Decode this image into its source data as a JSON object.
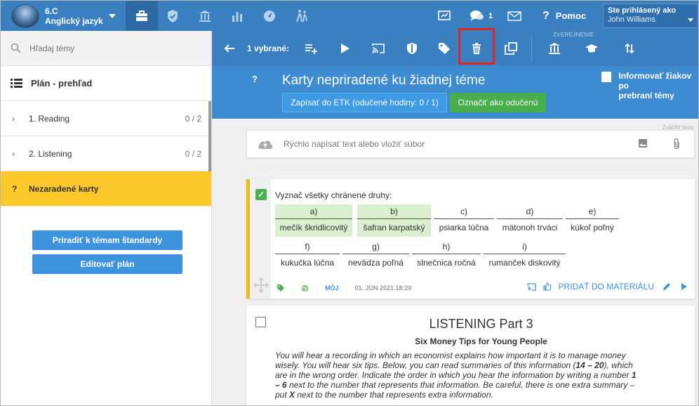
{
  "topbar": {
    "class_code": "6.C",
    "class_name": "Anglický jazyk",
    "chat_count": "1",
    "help_label": "Pomoc",
    "user_label": "Ste prihlásený ako",
    "user_name": "John Williams"
  },
  "sidebar": {
    "search_placeholder": "Hľadaj témy",
    "plan_label": "Plán - prehľad",
    "items": [
      {
        "chev": "›",
        "label": "1. Reading",
        "count": "0 / 2"
      },
      {
        "chev": "›",
        "label": "2. Listening",
        "count": "0 / 2"
      },
      {
        "chev": "?",
        "label": "Nezaradené karty",
        "count": ""
      }
    ],
    "assign_button": "Priradiť k témam štandardy",
    "edit_button": "Editovať plán"
  },
  "actionbar": {
    "selected_label": "1 vybrané:",
    "published_label": "ZVEREJNENIE"
  },
  "header": {
    "qmark": "?",
    "title": "Karty nepriradené ku žiadnej téme",
    "etk_button": "Zapísať do ETK (odučené hodiny: 0 / 1)",
    "done_button": "Označiť ako odučenú",
    "inform_line1": "Informovať žiakov po",
    "inform_line2": "prebraní témy"
  },
  "content": {
    "tiny_note": "Zväčšiť texty",
    "quick_placeholder": "Rýchlo napísať text alebo vložiť súbor",
    "card1": {
      "prompt": "Vyznač všetky chránené druhy:",
      "options": [
        {
          "letter": "a)",
          "value": "mečík škridlicovitý",
          "selected": true
        },
        {
          "letter": "b)",
          "value": "šafran karpatský",
          "selected": true
        },
        {
          "letter": "c)",
          "value": "psiarka lúčna",
          "selected": false
        },
        {
          "letter": "d)",
          "value": "mätonoh trváci",
          "selected": false
        },
        {
          "letter": "e)",
          "value": "kúkoľ poľný",
          "selected": false
        },
        {
          "letter": "f)",
          "value": "kukučka lúčna",
          "selected": false
        },
        {
          "letter": "g)",
          "value": "nevädza poľná",
          "selected": false
        },
        {
          "letter": "h)",
          "value": "slnečnica ročná",
          "selected": false
        },
        {
          "letter": "i)",
          "value": "rumanček diskovitý",
          "selected": false
        }
      ],
      "owner": "MÔJ",
      "date": "01. JÚN 2021 18:20",
      "add_label": "PRIDAŤ DO MATERIÁLU"
    },
    "card2": {
      "title": "LISTENING Part 3",
      "subtitle": "Six Money Tips for Young People",
      "body_part1": "You will hear a recording in which an economist explains how important it is to manage money wisely. You will hear six tips. Below, you can read summaries of this information (",
      "range": "14 – 20",
      "body_part2": "), which are in the wrong order. Indicate the order in which you hear the information by writing a number ",
      "numbers": "1 – 6",
      "body_part3": " next to the number that represents that information. Be careful, there is one extra summary – put ",
      "x_mark": "X",
      "body_part4": " next to the number that represents extra information."
    }
  },
  "colors": {
    "topbar": "#3a7fbf",
    "header_band": "#3d8bd1",
    "selected_sidebar": "#fcc82a",
    "done_green": "#48ad4b",
    "highlight_red": "#e5211f",
    "option_selected": "#d9efcd"
  }
}
